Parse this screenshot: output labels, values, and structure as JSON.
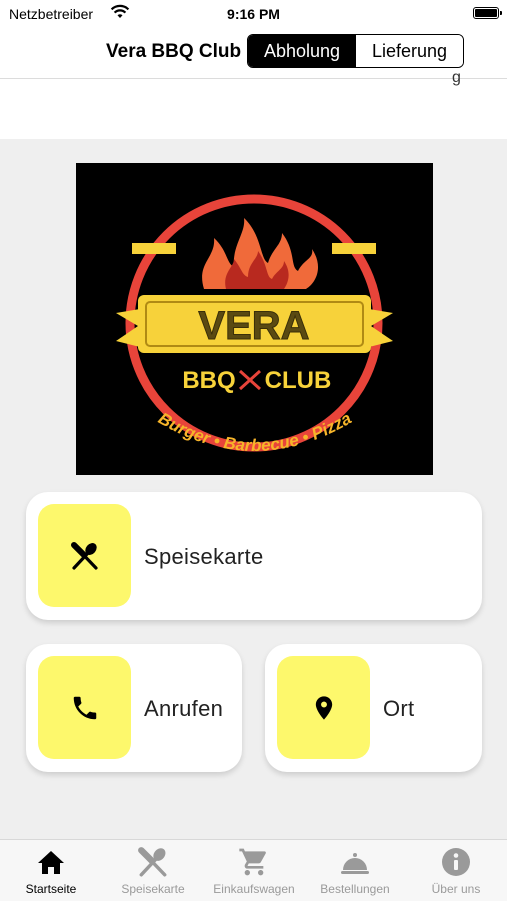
{
  "status_bar": {
    "carrier": "Netzbetreiber",
    "time": "9:16 PM"
  },
  "nav": {
    "title": "Vera BBQ Club",
    "segments": [
      {
        "label": "Abholung",
        "selected": true
      },
      {
        "label": "Lieferung",
        "selected": false
      }
    ]
  },
  "logo": {
    "name": "VERA",
    "sub": "BBQ",
    "sub2": "CLUB",
    "tagline": "Burger • Barbecue • Pizza"
  },
  "cards": {
    "menu_label": "Speisekarte",
    "call_label": "Anrufen",
    "location_label": "Ort"
  },
  "tabs": [
    {
      "label": "Startseite",
      "icon": "home-icon",
      "active": true
    },
    {
      "label": "Speisekarte",
      "icon": "utensils-icon",
      "active": false
    },
    {
      "label": "Einkaufswagen",
      "icon": "cart-icon",
      "active": false
    },
    {
      "label": "Bestellungen",
      "icon": "cloche-icon",
      "active": false
    },
    {
      "label": "Über uns",
      "icon": "info-icon",
      "active": false
    }
  ],
  "colors": {
    "accent_tile": "#fdf86c",
    "active_tab": "#000000",
    "inactive_tab": "#9a9a9a",
    "logo_red": "#e8443a",
    "logo_yellow": "#f7d23a"
  }
}
